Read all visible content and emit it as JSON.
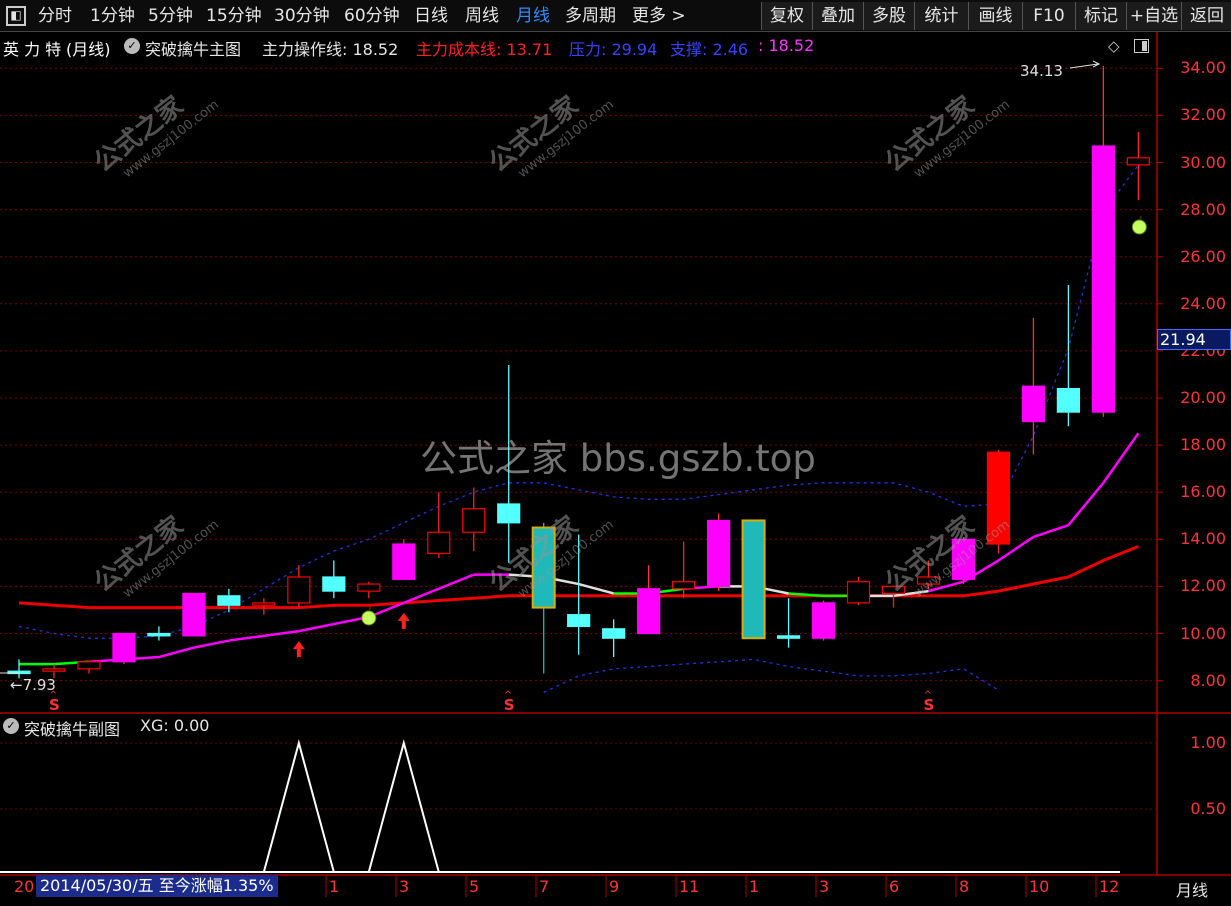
{
  "toolbar": {
    "periods": [
      "分时",
      "1分钟",
      "5分钟",
      "15分钟",
      "30分钟",
      "60分钟",
      "日线",
      "周线",
      "月线",
      "多周期",
      "更多 >"
    ],
    "active_period": "月线",
    "right_buttons": [
      "复权",
      "叠加",
      "多股",
      "统计",
      "画线",
      "F10",
      "标记",
      "+自选",
      "返回"
    ]
  },
  "main_header": {
    "stock_name": "英 力 特",
    "period": "(月线)",
    "indicator_name": "突破擒牛主图",
    "main_op_line_label": "主力操作线: 18.52",
    "main_cost_line_label": "主力成本线: 13.71",
    "pressure_label": "压力: 29.94",
    "support_label": "支撑: 2.46",
    "extra_value": ": 18.52"
  },
  "sub_header": {
    "indicator_name": "突破擒牛副图",
    "xg_label": "XG: 0.00"
  },
  "watermark": {
    "big_text": "公式之家 bbs.gszb.top",
    "small_cn": "公式之家",
    "small_url": "www.gszj100.com"
  },
  "price_axis": {
    "labels": [
      "34.00",
      "32.00",
      "30.00",
      "28.00",
      "26.00",
      "24.00",
      "22.00",
      "20.00",
      "18.00",
      "16.00",
      "14.00",
      "12.00",
      "10.00",
      "8.00"
    ],
    "current_price": "21.94"
  },
  "sub_axis": {
    "labels": [
      "1.00",
      "0.50"
    ]
  },
  "annotations": {
    "high_label": "34.13",
    "low_label": "7.93",
    "s_marker": "S"
  },
  "time_axis": {
    "date_info": "2014/05/30/五  至今涨幅1.35%",
    "year_label": "20",
    "month_labels": [
      "1",
      "3",
      "5",
      "7",
      "9",
      "11",
      "1",
      "3",
      "6",
      "8",
      "10",
      "12"
    ],
    "period_label": "月线"
  },
  "colors": {
    "up": "#ff0000",
    "magenta": "#ff00ff",
    "cyan_down": "#54ffff",
    "teal": "#20b8b8",
    "cost_line": "#ee0000",
    "band": "#2233dd",
    "grid": "#7a0000"
  },
  "chart_data": {
    "type": "candlestick",
    "ylim": [
      7,
      35
    ],
    "candles": [
      {
        "o": 8.3,
        "h": 8.9,
        "l": 8.1,
        "c": 8.4,
        "k": "cyan"
      },
      {
        "o": 8.4,
        "h": 8.7,
        "l": 8.1,
        "c": 8.5,
        "k": "hollow"
      },
      {
        "o": 8.5,
        "h": 8.8,
        "l": 8.3,
        "c": 8.8,
        "k": "hollow"
      },
      {
        "o": 8.8,
        "h": 10.0,
        "l": 8.7,
        "c": 10.0,
        "k": "mag"
      },
      {
        "o": 10.0,
        "h": 10.3,
        "l": 9.7,
        "c": 9.9,
        "k": "cyan"
      },
      {
        "o": 9.9,
        "h": 11.7,
        "l": 9.9,
        "c": 11.7,
        "k": "mag"
      },
      {
        "o": 11.6,
        "h": 11.9,
        "l": 10.9,
        "c": 11.2,
        "k": "cyan"
      },
      {
        "o": 11.2,
        "h": 11.5,
        "l": 10.8,
        "c": 11.3,
        "k": "hollow"
      },
      {
        "o": 11.3,
        "h": 12.9,
        "l": 11.1,
        "c": 12.4,
        "k": "hollow"
      },
      {
        "o": 12.4,
        "h": 13.1,
        "l": 11.5,
        "c": 11.8,
        "k": "cyan"
      },
      {
        "o": 11.8,
        "h": 12.2,
        "l": 11.5,
        "c": 12.1,
        "k": "hollow"
      },
      {
        "o": 12.3,
        "h": 14.0,
        "l": 12.3,
        "c": 13.8,
        "k": "mag"
      },
      {
        "o": 13.4,
        "h": 16.0,
        "l": 13.2,
        "c": 14.3,
        "k": "hollow"
      },
      {
        "o": 14.3,
        "h": 16.2,
        "l": 13.5,
        "c": 15.3,
        "k": "hollow"
      },
      {
        "o": 15.5,
        "h": 21.4,
        "l": 13.0,
        "c": 14.7,
        "k": "cyan"
      },
      {
        "o": 14.5,
        "h": 14.7,
        "l": 8.3,
        "c": 11.1,
        "k": "teal"
      },
      {
        "o": 10.8,
        "h": 14.2,
        "l": 9.1,
        "c": 10.3,
        "k": "cyan"
      },
      {
        "o": 10.2,
        "h": 10.6,
        "l": 9.0,
        "c": 9.8,
        "k": "cyan"
      },
      {
        "o": 10.0,
        "h": 12.9,
        "l": 10.0,
        "c": 11.9,
        "k": "mag"
      },
      {
        "o": 11.9,
        "h": 13.9,
        "l": 11.5,
        "c": 12.2,
        "k": "hollow"
      },
      {
        "o": 12.0,
        "h": 15.1,
        "l": 11.8,
        "c": 14.8,
        "k": "mag"
      },
      {
        "o": 14.8,
        "h": 14.8,
        "l": 9.8,
        "c": 9.8,
        "k": "teal"
      },
      {
        "o": 9.9,
        "h": 11.5,
        "l": 9.4,
        "c": 9.8,
        "k": "cyan"
      },
      {
        "o": 9.8,
        "h": 11.4,
        "l": 9.7,
        "c": 11.3,
        "k": "mag"
      },
      {
        "o": 11.3,
        "h": 12.4,
        "l": 11.2,
        "c": 12.2,
        "k": "hollow"
      },
      {
        "o": 12.0,
        "h": 12.0,
        "l": 11.1,
        "c": 11.7,
        "k": "hollow"
      },
      {
        "o": 12.1,
        "h": 13.1,
        "l": 11.9,
        "c": 12.4,
        "k": "hollow"
      },
      {
        "o": 12.3,
        "h": 14.1,
        "l": 12.1,
        "c": 14.0,
        "k": "mag"
      },
      {
        "o": 13.8,
        "h": 17.8,
        "l": 13.4,
        "c": 17.7,
        "k": "red"
      },
      {
        "o": 19.0,
        "h": 23.4,
        "l": 17.6,
        "c": 20.5,
        "k": "mag"
      },
      {
        "o": 19.4,
        "h": 24.8,
        "l": 18.8,
        "c": 20.4,
        "k": "cyan"
      },
      {
        "o": 19.4,
        "h": 34.1,
        "l": 19.2,
        "c": 30.7,
        "k": "mag"
      },
      {
        "o": 29.9,
        "h": 31.3,
        "l": 28.4,
        "c": 30.2,
        "k": "hollow"
      }
    ],
    "op_line": [
      8.7,
      8.7,
      8.8,
      8.9,
      9.0,
      9.4,
      9.7,
      9.9,
      10.1,
      10.4,
      10.7,
      11.3,
      11.9,
      12.5,
      12.5,
      12.4,
      12.1,
      11.7,
      11.7,
      11.9,
      12.0,
      12.0,
      11.7,
      11.6,
      11.6,
      11.6,
      11.8,
      12.2,
      13.1,
      14.1,
      14.6,
      16.4,
      18.5
    ],
    "cost_line": [
      11.3,
      11.2,
      11.1,
      11.1,
      11.1,
      11.1,
      11.1,
      11.1,
      11.1,
      11.2,
      11.2,
      11.3,
      11.4,
      11.5,
      11.6,
      11.6,
      11.6,
      11.6,
      11.6,
      11.6,
      11.6,
      11.6,
      11.6,
      11.6,
      11.6,
      11.6,
      11.6,
      11.6,
      11.8,
      12.1,
      12.4,
      13.1,
      13.7
    ],
    "upper_band": [
      10.3,
      10.0,
      9.8,
      9.8,
      9.9,
      10.3,
      11.0,
      11.9,
      12.8,
      13.5,
      14.0,
      14.7,
      15.4,
      16.0,
      16.4,
      16.4,
      16.1,
      15.8,
      15.7,
      15.7,
      15.9,
      16.1,
      16.3,
      16.4,
      16.4,
      16.4,
      16.0,
      15.4,
      15.5,
      18.4,
      22.1,
      27.9,
      29.9
    ],
    "lower_band": [
      null,
      null,
      null,
      null,
      null,
      null,
      null,
      null,
      null,
      null,
      null,
      null,
      null,
      null,
      null,
      7.5,
      8.2,
      8.5,
      8.6,
      8.7,
      8.8,
      8.9,
      8.6,
      8.4,
      8.2,
      8.2,
      8.3,
      8.5,
      7.6,
      null,
      null,
      null,
      null
    ],
    "xg_signal": [
      0,
      0,
      0,
      0,
      0,
      0,
      0,
      0,
      1,
      0,
      0,
      1,
      0,
      0,
      0,
      0,
      0,
      0,
      0,
      0,
      0,
      0,
      0,
      0,
      0,
      0,
      0,
      0,
      0,
      0,
      0,
      0,
      0
    ],
    "s_markers": [
      1,
      14,
      26
    ],
    "up_arrows": [
      8,
      11
    ],
    "apples": [
      10,
      32
    ]
  }
}
